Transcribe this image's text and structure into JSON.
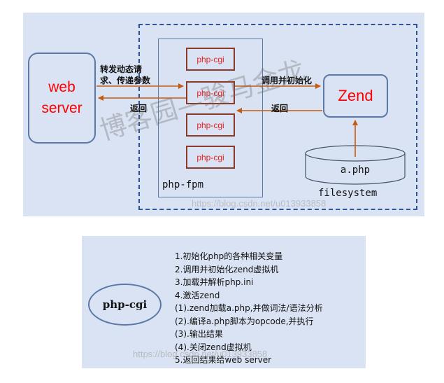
{
  "colors": {
    "panel_bg": "#dae3f3",
    "box_border": "#5b78a6",
    "dashed_border": "#2e5496",
    "arrow": "#c55a11",
    "accent_text": "#ff0000"
  },
  "top": {
    "web_server_label": "web\nserver",
    "fpm_label": "php-fpm",
    "cgi_labels": [
      "php-cgi",
      "php-cgi",
      "php-cgi",
      "php-cgi"
    ],
    "zend_label": "Zend",
    "file_label": "a.php",
    "filesystem_label": "filesystem",
    "request_label_line1": "转发动态请",
    "request_label_line2": "求、传递参数",
    "return_label_left": "返回",
    "call_label": "调用并初始化",
    "return_label_right": "返回",
    "watermark": "博客园—骏马金龙",
    "url_watermark": "https://blog.csdn.net/u013933858"
  },
  "bottom": {
    "cgi_label": "php-cgi",
    "steps": [
      "1.初始化php的各种相关变量",
      "2.调用并初始化zend虚拟机",
      "3.加载并解析php.ini",
      "4.激活zend",
      "(1).zend加载a.php,并做词法/语法分析",
      "(2).编译a.php脚本为opcode,并执行",
      "(3).输出结果",
      "(4).关闭zend虚拟机",
      "5.返回结果给web server"
    ],
    "url_watermark": "https://blog.csdn.net/u013933858"
  }
}
